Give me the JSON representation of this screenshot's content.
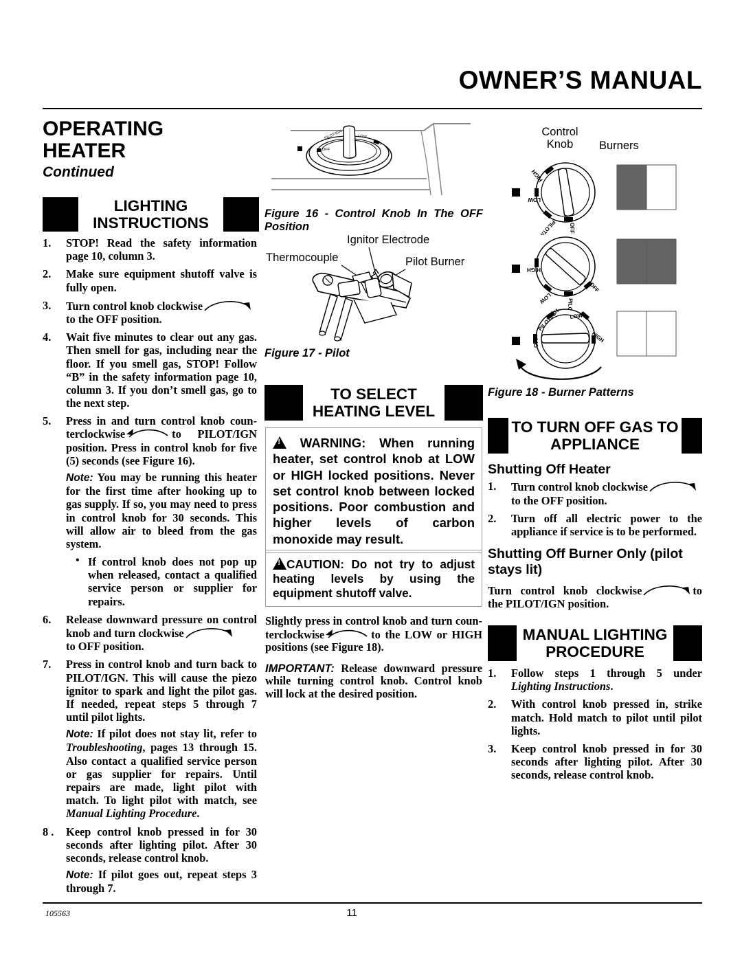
{
  "header": {
    "title": "OWNER’S MANUAL"
  },
  "footer": {
    "doc_code": "105563",
    "page_number": "11"
  },
  "section": {
    "title_line1": "OPERATING",
    "title_line2": "HEATER",
    "continued": "Continued"
  },
  "lighting_instructions": {
    "heading_line1": "LIGHTING",
    "heading_line2": "INSTRUCTIONS",
    "steps": [
      {
        "num": "1.",
        "text": "STOP! Read the safety information page 10, column 3."
      },
      {
        "num": "2.",
        "text": "Make sure equipment shutoff valve is fully open."
      },
      {
        "num": "3.",
        "text": "Turn control knob clockwise",
        "text_after": "to the OFF position."
      },
      {
        "num": "4.",
        "text": "Wait five minutes to clear out any gas. Then smell for gas, including near the floor. If you smell gas, STOP! Follow “B” in the safety information page 10, column 3. If you don’t smell gas, go to the next step."
      },
      {
        "num": "5.",
        "text": "Press in and turn control knob coun-terclockwise",
        "text_after": "to PILOT/IGN position. Press in control knob for five (5) seconds (see Figure 16)."
      },
      {
        "num": "6.",
        "text": "Release downward pressure on control knob and turn clockwise",
        "text_after": "to OFF position."
      },
      {
        "num": "7.",
        "text": "Press in control knob and turn back to PILOT/IGN. This will cause the piezo ignitor to spark and light the pilot gas. If needed, repeat steps 5 through 7 until pilot lights."
      },
      {
        "num": "8 .",
        "text": "Keep control knob pressed in for 30 seconds after lighting pilot. After 30 seconds, release control knob."
      }
    ],
    "note_5_label": "Note:",
    "note_5_text": " You may be running this heater for the first time after hooking up to gas supply. If so, you may need to press in control knob for 30 seconds. This will allow air to bleed from the gas system.",
    "bullet_5": "If control knob does not pop up when released, contact a qualified service person or supplier for repairs.",
    "note_7_label": "Note:",
    "note_7_text_a": " If pilot does not stay lit, refer to ",
    "note_7_italic_a": "Troubleshooting",
    "note_7_text_b": ", pages 13 through 15.  Also contact a qualified service person or gas supplier for repairs. Until repairs are made, light pilot with match. To light pilot with match, see ",
    "note_7_italic_b": "Manual Lighting Procedure",
    "note_7_text_c": ".",
    "note_8_label": "Note:",
    "note_8_text": " If pilot goes out, repeat steps 3 through 7."
  },
  "figure16": {
    "caption": "Figure 16 - Control Knob In The OFF Position",
    "knob_labels": [
      "OFF",
      "PILOT/IGN",
      "LOW",
      "HIGH"
    ]
  },
  "figure17": {
    "caption": "Figure 17 - Pilot",
    "label_thermocouple": "Thermocouple",
    "label_ignitor": "Ignitor Electrode",
    "label_pilot_burner": "Pilot Burner"
  },
  "figure18": {
    "caption": "Figure 18 - Burner Patterns",
    "col_label_knob_line1": "Control",
    "col_label_knob_line2": "Knob",
    "col_label_burners": "Burners",
    "rows": [
      {
        "knob_position": "LOW",
        "knob_labels": [
          "HIGH",
          "LOW",
          "PILOT/IGN",
          "OFF"
        ],
        "burner_left_lit": true,
        "burner_right_lit": false
      },
      {
        "knob_position": "HIGH",
        "knob_labels": [
          "HIGH",
          "LOW",
          "PILOT/IGN",
          "OFF"
        ],
        "burner_left_lit": true,
        "burner_right_lit": true
      },
      {
        "knob_position": "OFF",
        "knob_labels": [
          "PILOT/IGN",
          "LOW",
          "HIGH",
          "OFF"
        ],
        "burner_left_lit": false,
        "burner_right_lit": false
      }
    ]
  },
  "to_select_heating_level": {
    "heading_line1": "TO SELECT",
    "heading_line2": "HEATING LEVEL",
    "warning_label": "WARNING:",
    "warning_text": " When running heater, set control knob at LOW or HIGH locked positions. Never set control knob between locked positions. Poor combustion and higher levels of carbon monoxide may result.",
    "caution_label": "CAUTION:",
    "caution_text": " Do not try to adjust heating levels by using the equipment shutoff valve.",
    "body_a": "Slightly press in control knob and turn coun-terclockwise",
    "body_a_after": "to the LOW or HIGH positions (see Figure 18).",
    "important_label": "IMPORTANT:",
    "important_text": " Release downward pressure while turning control knob. Control knob will lock at the desired position."
  },
  "to_turn_off_gas": {
    "heading_line1": "TO TURN OFF GAS TO",
    "heading_line2": "APPLIANCE",
    "sub1": "Shutting Off Heater",
    "steps": [
      {
        "num": "1.",
        "text": "Turn control knob clockwise",
        "text_after": "to the OFF position."
      },
      {
        "num": "2.",
        "text": "Turn off all electric power to the appliance if service is to be performed."
      }
    ],
    "sub2_line1": "Shutting Off Burner Only (pilot",
    "sub2_line2": "stays lit)",
    "body": "Turn control knob clockwise",
    "body_after": "to the PILOT/IGN position."
  },
  "manual_lighting": {
    "heading_line1": "MANUAL LIGHTING",
    "heading_line2": "PROCEDURE",
    "steps": [
      {
        "num": "1.",
        "text": "Follow steps 1 through 5 under ",
        "italic": "Lighting Instructions",
        "text_after": "."
      },
      {
        "num": "2.",
        "text": "With control knob pressed in, strike match. Hold match to pilot until pilot lights."
      },
      {
        "num": "3.",
        "text": "Keep control knob pressed in for 30 seconds after lighting pilot. After 30 seconds, release control knob."
      }
    ]
  },
  "colors": {
    "ink": "#000000",
    "burner_lit": "#636363",
    "burner_unlit": "#ffffff",
    "alert_border": "#9a9a9a",
    "line_gray": "#8a8a8a"
  }
}
